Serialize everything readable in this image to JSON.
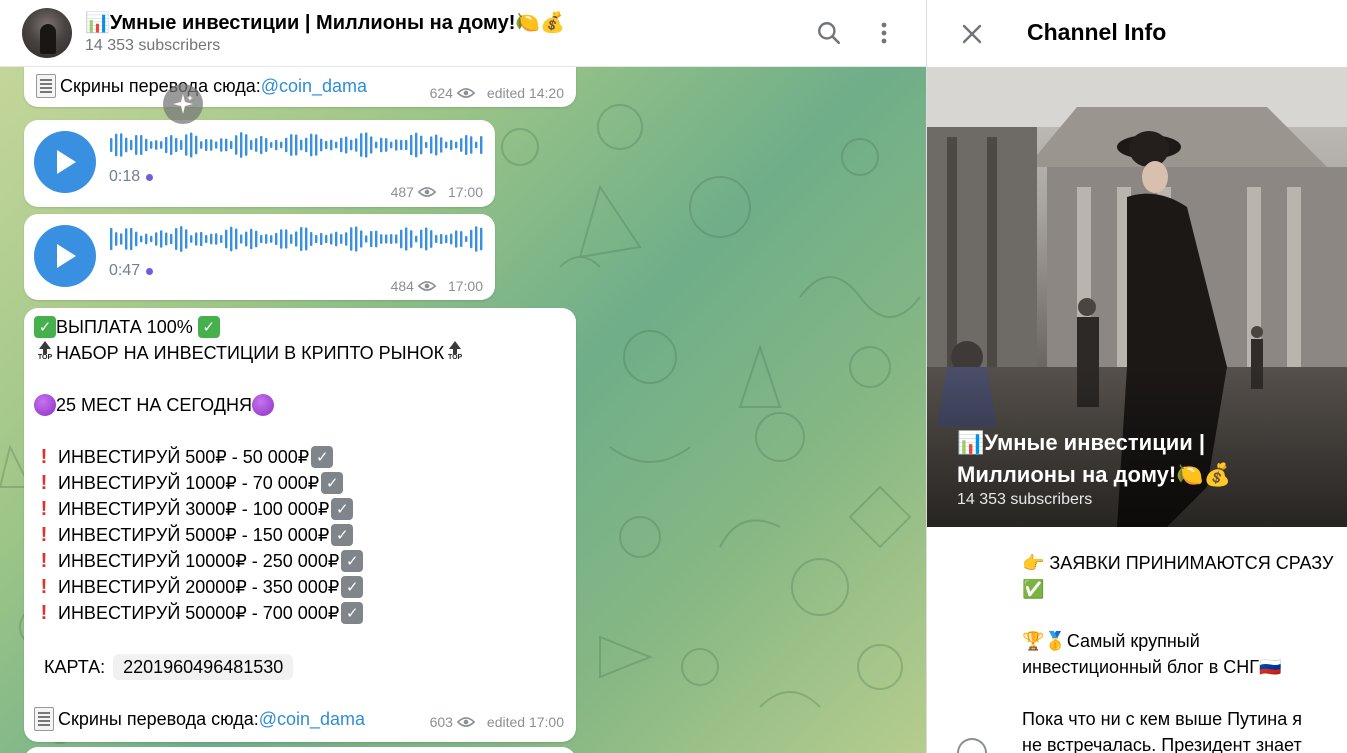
{
  "chat_header": {
    "title": "📊Умные инвестиции | Миллионы на дому!🍋💰",
    "subscribers": "14 353 subscribers"
  },
  "messages": [
    {
      "type": "text_tail",
      "text_prefix": "Скрины перевода сюда: ",
      "link": "@coin_dama",
      "views": "624",
      "time": "edited 14:20"
    },
    {
      "type": "voice",
      "duration": "0:18",
      "views": "487",
      "time": "17:00"
    },
    {
      "type": "voice",
      "duration": "0:47",
      "views": "484",
      "time": "17:00"
    },
    {
      "type": "post",
      "line1": "ВЫПЛАТА 100%",
      "line2": "НАБОР НА ИНВЕСТИЦИИ В КРИПТО РЫНОК",
      "line3": "25 МЕСТ НА СЕГОДНЯ",
      "invest_rows": [
        "ИНВЕСТИРУЙ 500₽  -  50 000₽",
        "ИНВЕСТИРУЙ 1000₽ - 70 000₽",
        "ИНВЕСТИРУЙ 3000₽ - 100 000₽",
        "ИНВЕСТИРУЙ 5000₽ - 150 000₽",
        "ИНВЕСТИРУЙ 10000₽ - 250 000₽",
        "ИНВЕСТИРУЙ 20000₽ - 350 000₽",
        "ИНВЕСТИРУЙ 50000₽ - 700 000₽"
      ],
      "card_label": "КАРТА:",
      "card_number": "2201960496481530",
      "footer_prefix": "Скрины перевода сюда: ",
      "footer_link": "@coin_dama",
      "views": "603",
      "time": "edited 17:00"
    }
  ],
  "top_label": "TOP",
  "info_panel": {
    "title": "Channel Info",
    "channel_name_line1": "📊Умные инвестиции |",
    "channel_name_line2": "Миллионы на дому!🍋💰",
    "subscribers": "14 353 subscribers",
    "desc_1": "👉 ЗАЯВКИ ПРИНИМАЮТСЯ СРАЗУ",
    "desc_1b": "✅",
    "desc_2a": "🏆🥇Самый крупный",
    "desc_2b": "инвестиционный блог в СНГ🇷🇺",
    "desc_3a": "Пока что ни с кем выше Путина я",
    "desc_3b": "не встречалась. Президент знает"
  },
  "colors": {
    "accent_blue": "#3a90e0",
    "link": "#2e8dd8",
    "wave": "#3a90e0",
    "check_green": "#45b04c"
  },
  "icons": [
    "search-icon",
    "more-vertical-icon",
    "close-icon",
    "play-icon",
    "eye-icon",
    "sparkle-icon",
    "receipt-icon",
    "info-icon"
  ]
}
